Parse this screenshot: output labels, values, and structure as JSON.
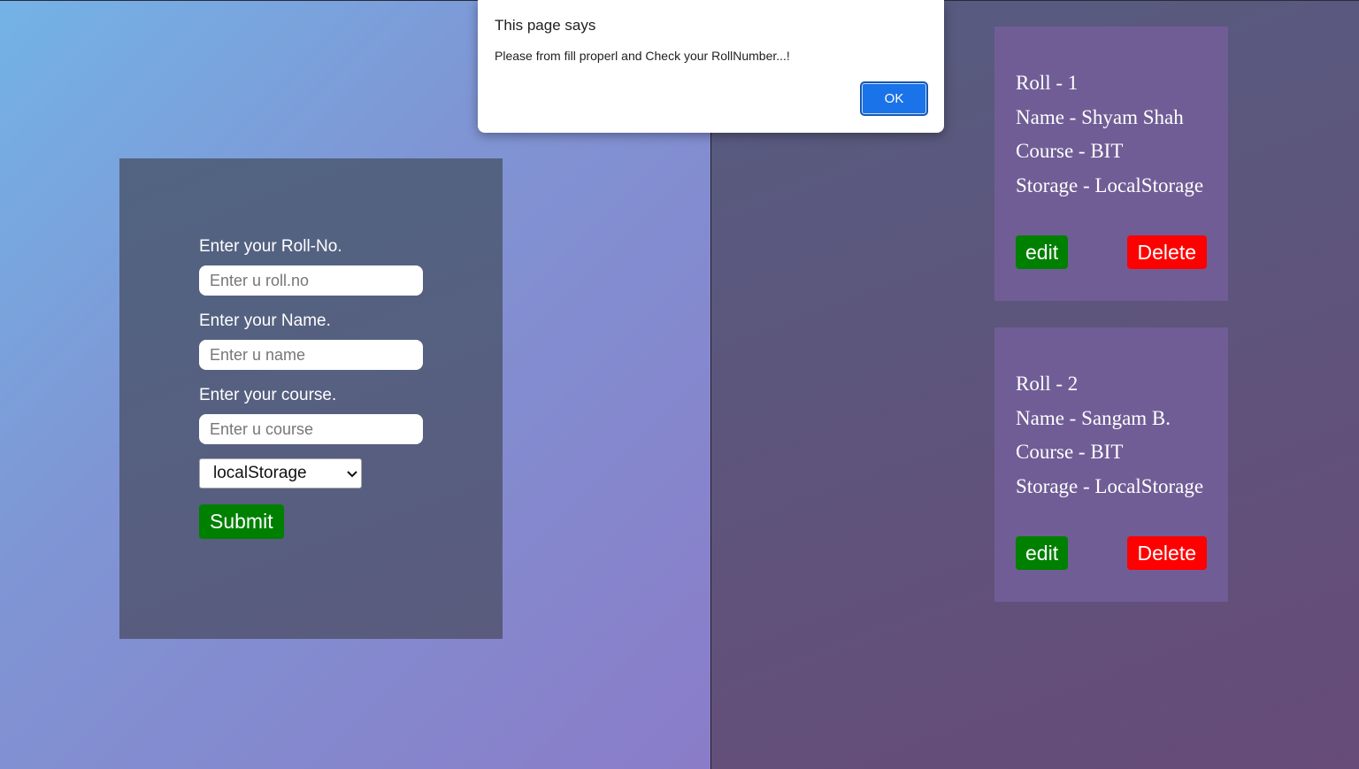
{
  "form": {
    "rollno_label": "Enter your Roll-No.",
    "rollno_placeholder": "Enter u roll.no",
    "name_label": "Enter your Name.",
    "name_placeholder": "Enter u name",
    "course_label": "Enter your course.",
    "course_placeholder": "Enter u course",
    "storage_selected": "localStorage",
    "submit_label": "Submit"
  },
  "records": [
    {
      "roll": "Roll - 1",
      "name": "Name - Shyam Shah",
      "course": "Course - BIT",
      "storage": "Storage - LocalStorage",
      "edit_label": "edit",
      "delete_label": "Delete"
    },
    {
      "roll": "Roll - 2",
      "name": "Name - Sangam B.",
      "course": "Course - BIT",
      "storage": "Storage - LocalStorage",
      "edit_label": "edit",
      "delete_label": "Delete"
    }
  ],
  "dialog": {
    "title": "This page says",
    "message": "Please from fill properl and Check your RollNumber...!",
    "ok_label": "OK"
  },
  "colors": {
    "submit_green": "#008000",
    "delete_red": "#ff0000",
    "card_purple": "#705d96",
    "ok_blue": "#1a73e8"
  },
  "icons": {
    "select_arrow": "chevron-down-icon"
  }
}
